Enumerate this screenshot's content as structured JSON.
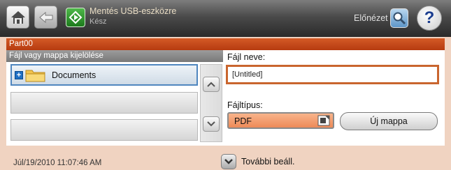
{
  "header": {
    "title": "Mentés USB-eszközre",
    "status": "Kész",
    "preview_label": "Előnézet",
    "help_glyph": "?",
    "icons": {
      "home": "home-icon",
      "back": "back-arrow-icon",
      "usb": "usb-save-icon",
      "preview": "magnifier-icon",
      "help": "help-icon"
    }
  },
  "location_bar": {
    "label": "Part00"
  },
  "file_browser": {
    "header": "Fájl vagy mappa kijelölése",
    "items": [
      {
        "label": "Documents",
        "icon": "folder-icon",
        "expand_glyph": "+",
        "selected": true
      },
      {
        "label": ""
      },
      {
        "label": ""
      }
    ]
  },
  "file_name": {
    "label": "Fájl neve:",
    "value": "[Untitled]"
  },
  "file_type": {
    "label": "Fájltípus:",
    "value": "PDF"
  },
  "new_folder_button": {
    "label": "Új mappa"
  },
  "footer": {
    "timestamp": "Júl/19/2010 11:07:46 AM",
    "more_settings_label": "További beáll."
  },
  "colors": {
    "background": "#f0d3c1",
    "header_dark": "#2a2a2a",
    "accent_orange": "#c9652e",
    "selection_blue": "#4f86bf",
    "pdf_fill": "#f4a070"
  }
}
